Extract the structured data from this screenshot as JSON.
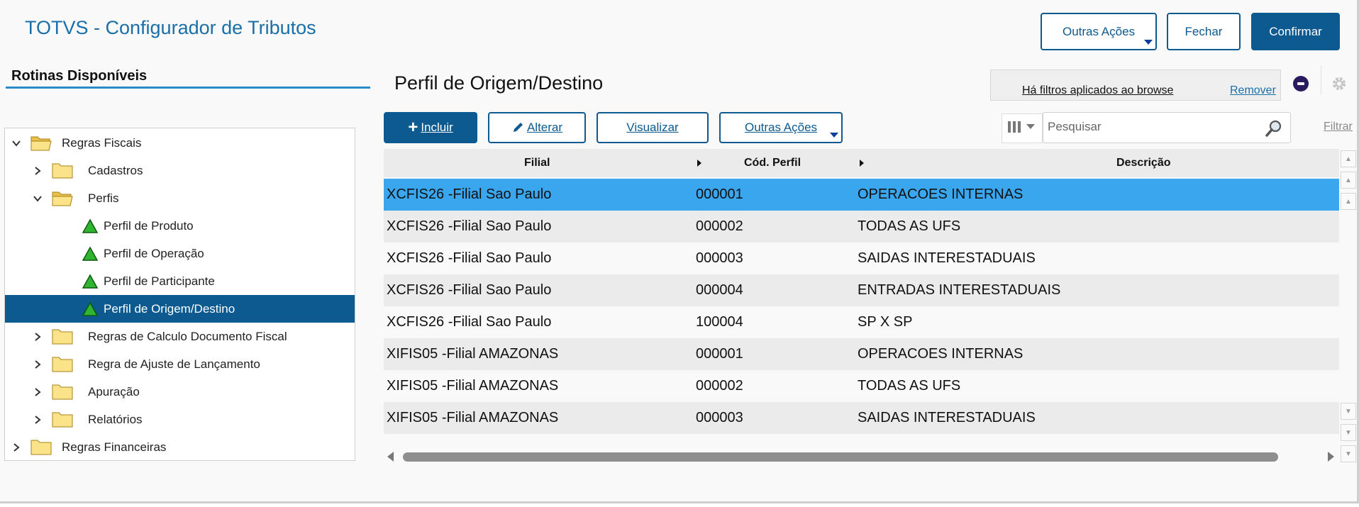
{
  "app": {
    "title": "TOTVS - Configurador de Tributos"
  },
  "header": {
    "other_actions_label": "Outras Ações",
    "close_label": "Fechar",
    "confirm_label": "Confirmar"
  },
  "sidebar": {
    "title": "Rotinas Disponíveis",
    "tree": [
      {
        "label": "Regras Fiscais",
        "state": "expanded",
        "icon": "folder-open-icon"
      },
      {
        "label": "Cadastros",
        "state": "collapsed",
        "icon": "folder-icon"
      },
      {
        "label": "Perfis",
        "state": "expanded",
        "icon": "folder-open-icon"
      },
      {
        "label": "Perfil de Produto",
        "state": "leaf",
        "icon": "green-triangle-icon"
      },
      {
        "label": "Perfil de Operação",
        "state": "leaf",
        "icon": "green-triangle-icon"
      },
      {
        "label": "Perfil de Participante",
        "state": "leaf",
        "icon": "green-triangle-icon"
      },
      {
        "label": "Perfil de Origem/Destino",
        "state": "leaf-selected",
        "icon": "green-triangle-icon"
      },
      {
        "label": "Regras de Calculo Documento Fiscal",
        "state": "collapsed",
        "icon": "folder-icon"
      },
      {
        "label": "Regra de Ajuste de Lançamento",
        "state": "collapsed",
        "icon": "folder-icon"
      },
      {
        "label": "Apuração",
        "state": "collapsed",
        "icon": "folder-icon"
      },
      {
        "label": "Relatórios",
        "state": "collapsed",
        "icon": "folder-icon"
      },
      {
        "label": "Regras Financeiras",
        "state": "collapsed",
        "icon": "folder-icon"
      }
    ]
  },
  "main": {
    "title": "Perfil de Origem/Destino",
    "filter_notice": "Há filtros aplicados ao browse",
    "filter_remove": "Remover",
    "toolbar": {
      "include": "Incluir",
      "edit": "Alterar",
      "view": "Visualizar",
      "other_actions": "Outras Ações"
    },
    "search": {
      "placeholder": "Pesquisar"
    },
    "filter_link": "Filtrar",
    "grid": {
      "columns": [
        "Filial",
        "Cód. Perfil",
        "Descrição"
      ],
      "rows": [
        [
          "XCFIS26 -Filial Sao Paulo",
          "000001",
          "OPERACOES INTERNAS"
        ],
        [
          "XCFIS26 -Filial Sao Paulo",
          "000002",
          "TODAS AS UFS"
        ],
        [
          "XCFIS26 -Filial Sao Paulo",
          "000003",
          "SAIDAS INTERESTADUAIS"
        ],
        [
          "XCFIS26 -Filial Sao Paulo",
          "000004",
          "ENTRADAS INTERESTADUAIS"
        ],
        [
          "XCFIS26 -Filial Sao Paulo",
          "100004",
          "SP X SP"
        ],
        [
          "XIFIS05 -Filial AMAZONAS",
          "000001",
          "OPERACOES INTERNAS"
        ],
        [
          "XIFIS05 -Filial AMAZONAS",
          "000002",
          "TODAS AS UFS"
        ],
        [
          "XIFIS05 -Filial AMAZONAS",
          "000003",
          "SAIDAS INTERESTADUAIS"
        ]
      ],
      "selected_row": 0
    }
  },
  "colors": {
    "brand": "#0c5a8f",
    "title_blue": "#1a6fa8",
    "row_selected": "#3aa6ee",
    "row_alt": "#ebebeb"
  }
}
